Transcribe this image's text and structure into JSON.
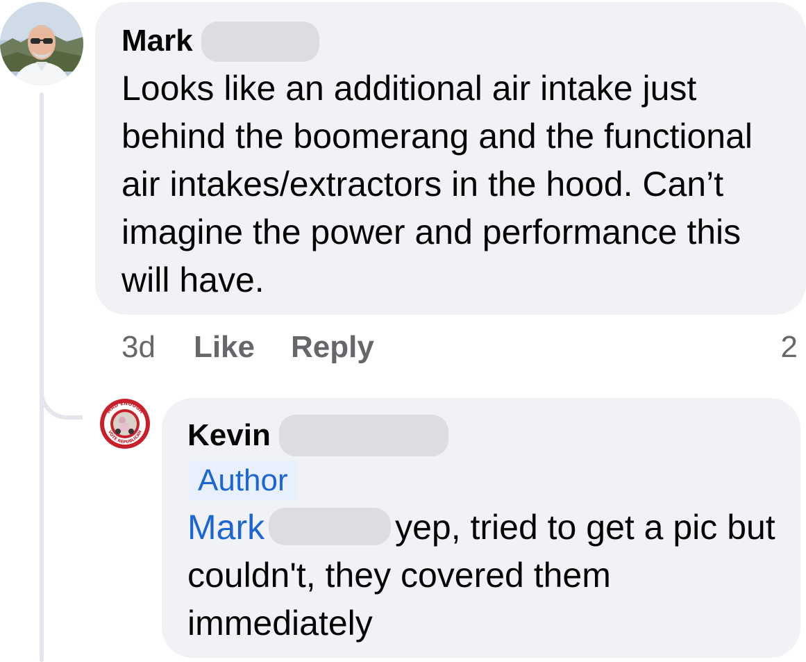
{
  "comment": {
    "author": "Mark",
    "text": "Looks like an additional air intake just behind the boomerang and the functional air intakes/extractors in the hood. Can’t imagine the power and performance this will have.",
    "time": "3d",
    "like_label": "Like",
    "reply_label": "Reply",
    "reaction_count": "2"
  },
  "reply": {
    "author": "Kevin",
    "badge": "Author",
    "mention": "Mark",
    "text_line1": "yep, tried to get a pic",
    "text_rest": "but couldn't,  they covered them immediately",
    "avatar_text_top": "MAD ENOUGH",
    "avatar_text_bottom": "VOTE REPUBLICAN"
  },
  "colors": {
    "bubble": "#f0f2f5",
    "link": "#1b66d2",
    "muted": "#65676b",
    "redaction": "#dcdde0"
  }
}
